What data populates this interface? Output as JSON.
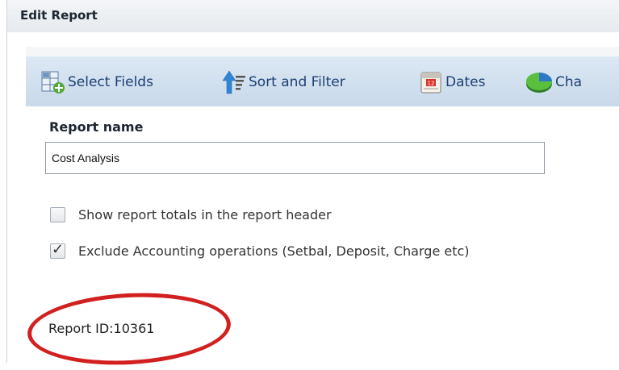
{
  "dialog": {
    "title": "Edit Report"
  },
  "toolbar": {
    "buttons": [
      {
        "label": "Select Fields",
        "icon": "select-fields-icon"
      },
      {
        "label": "Sort and Filter",
        "icon": "sort-filter-icon"
      },
      {
        "label": "Dates",
        "icon": "calendar-icon"
      },
      {
        "label": "Cha",
        "icon": "chart-icon"
      }
    ]
  },
  "form": {
    "report_name_label": "Report name",
    "report_name_value": "Cost Analysis",
    "options": [
      {
        "label": "Show report totals in the report header",
        "checked": false
      },
      {
        "label": "Exclude Accounting operations (Setbal, Deposit, Charge etc)",
        "checked": true
      }
    ],
    "report_id": "Report ID:10361"
  },
  "annotation": {
    "color": "#d1201f"
  },
  "colors": {
    "toolbar": "#d3e2f1",
    "toolbar_text": "#1d3f73"
  }
}
